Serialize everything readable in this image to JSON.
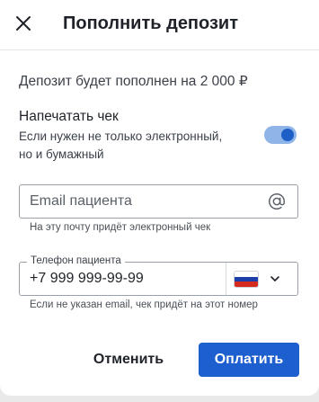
{
  "dialog": {
    "title": "Пополнить депозит",
    "close_icon": "close-icon"
  },
  "deposit": {
    "text": "Депозит будет пополнен на 2 000 ₽"
  },
  "receipt": {
    "title": "Напечатать чек",
    "subtitle": "Если нужен не только электронный, но и бумажный",
    "toggle_on": true
  },
  "email": {
    "placeholder": "Email пациента",
    "value": "",
    "icon": "at-sign-icon",
    "helper": "На эту почту придёт электронный чек"
  },
  "phone": {
    "label": "Телефон пациента",
    "value": "+7 999 999-99-99",
    "country_flag": "russia-flag-icon",
    "chevron_icon": "chevron-down-icon",
    "helper": "Если не указан email, чек придёт на этот номер"
  },
  "actions": {
    "cancel_label": "Отменить",
    "pay_label": "Оплатить"
  },
  "colors": {
    "primary": "#1d5fce",
    "toggle_track": "#8fb4e8",
    "toggle_knob": "#1e5fc7",
    "background": "#e9e9ea"
  }
}
